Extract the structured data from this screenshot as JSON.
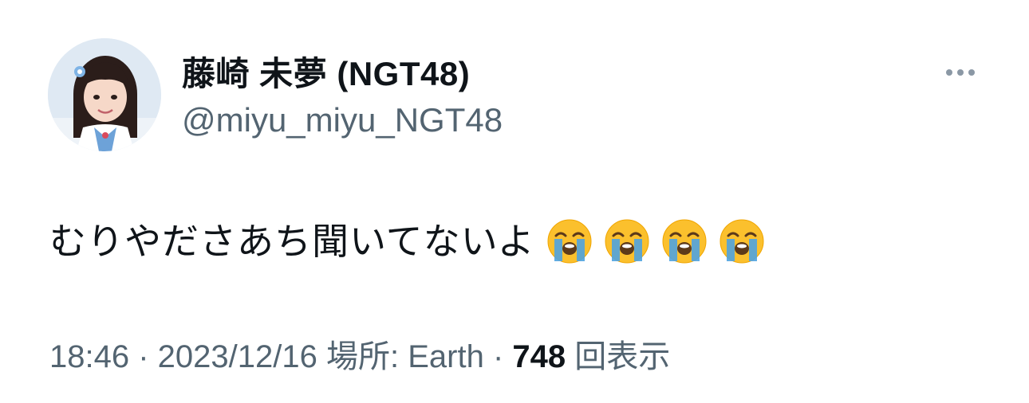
{
  "author": {
    "display_name": "藤崎 未夢 (NGT48)",
    "handle": "@miyu_miyu_NGT48"
  },
  "tweet": {
    "text": "むりやださあち聞いてないよ",
    "emojis": [
      "loudly-crying-face",
      "loudly-crying-face",
      "loudly-crying-face",
      "loudly-crying-face"
    ]
  },
  "meta": {
    "time": "18:46",
    "separator": " · ",
    "date": "2023/12/16",
    "location": "場所: Earth",
    "views_count": "748",
    "views_label": "回表示"
  },
  "icons": {
    "more": "more-horizontal-icon"
  },
  "colors": {
    "text_primary": "#0f1419",
    "text_secondary": "#536471",
    "background": "#ffffff"
  }
}
